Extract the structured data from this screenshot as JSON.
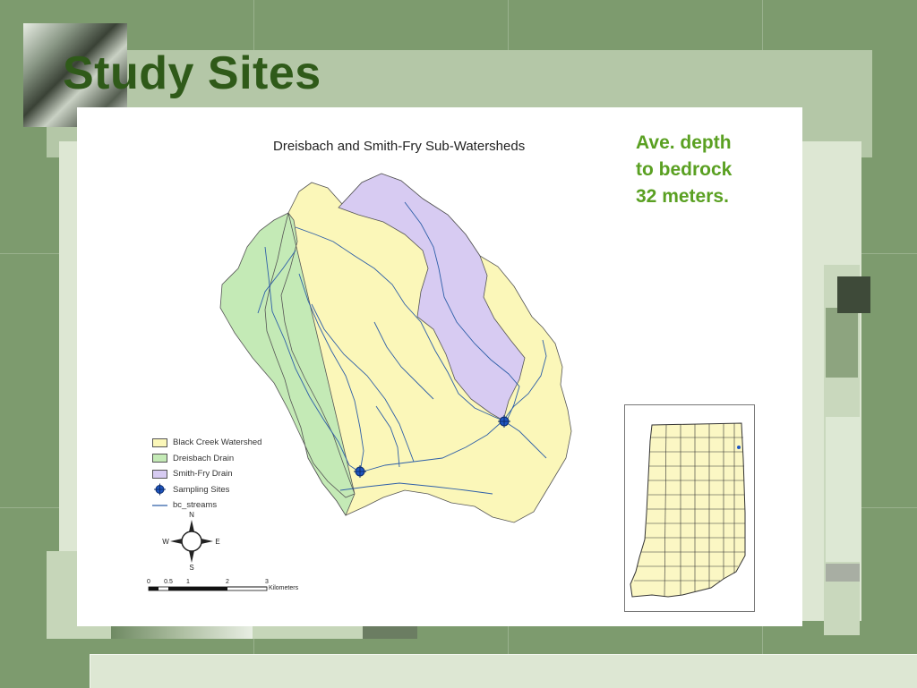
{
  "slide": {
    "title": "Study Sites",
    "note_lines": [
      "Ave. depth",
      "to bedrock",
      "32 meters."
    ]
  },
  "map": {
    "title": "Dreisbach and Smith-Fry Sub-Watersheds",
    "legend": [
      {
        "label": "Black Creek Watershed",
        "color": "#fbf7b9"
      },
      {
        "label": "Dreisbach Drain",
        "color": "#c4eab6"
      },
      {
        "label": "Smith-Fry Drain",
        "color": "#d7cbf2"
      },
      {
        "label": "Sampling Sites",
        "color": "#1f56c2"
      },
      {
        "label": "bc_streams",
        "color": "#2e5fa8"
      }
    ],
    "compass": {
      "n": "N",
      "s": "S",
      "e": "E",
      "w": "W"
    },
    "scale_bar": {
      "ticks": [
        "0",
        "0.5",
        "1",
        "2",
        "3"
      ],
      "unit": "Kilometers"
    }
  },
  "colors": {
    "background": "#7d9b6e",
    "title": "#2f5a19",
    "note": "#5aa022",
    "stream": "#2e5fa8",
    "site": "#1f56c2"
  }
}
